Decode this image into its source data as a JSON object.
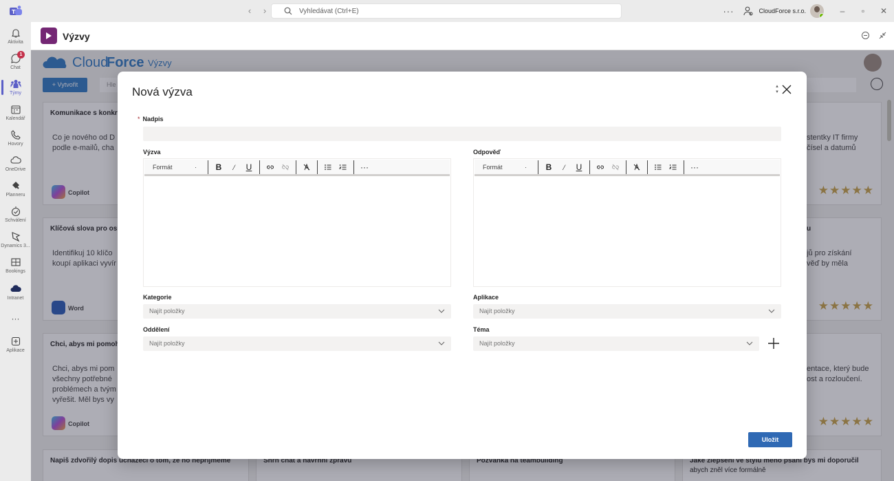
{
  "titlebar": {
    "search_placeholder": "Vyhledávat (Ctrl+E)",
    "more": "···",
    "org_name": "CloudForce s.r.o.",
    "nav_back": "‹",
    "nav_forward": "›",
    "minimize": "–",
    "restore": "▫",
    "close": "✕"
  },
  "rail": {
    "items": [
      {
        "label": "Aktivita",
        "icon": "bell-icon"
      },
      {
        "label": "Chat",
        "icon": "chat-icon",
        "badge": "1"
      },
      {
        "label": "Týmy",
        "icon": "teams-icon",
        "active": true
      },
      {
        "label": "Kalendář",
        "icon": "calendar-icon"
      },
      {
        "label": "Hovory",
        "icon": "phone-icon"
      },
      {
        "label": "OneDrive",
        "icon": "cloud-icon"
      },
      {
        "label": "Planneru",
        "icon": "planner-icon"
      },
      {
        "label": "Schválení",
        "icon": "approvals-icon"
      },
      {
        "label": "Dynamics 3...",
        "icon": "dynamics-icon"
      },
      {
        "label": "Bookings",
        "icon": "bookings-icon"
      },
      {
        "label": "Intranet",
        "icon": "intranet-cloud-icon"
      },
      {
        "label": "···",
        "icon": "more-icon"
      },
      {
        "label": "Aplikace",
        "icon": "add-app-icon"
      }
    ]
  },
  "app_header": {
    "title": "Výzvy"
  },
  "background": {
    "logo_light": "Cloud",
    "logo_bold": "Force",
    "logo_sub": "Výzvy",
    "create_label": "+ Vytvořit",
    "search_partial": "Hle",
    "cards": [
      {
        "title": "Komunikace s konkr",
        "body1": "Co je nového od D",
        "body2": "podle e-mailů, cha",
        "app": "Copilot"
      },
      {
        "title": "Klíčová slova pro osl",
        "body1": "Identifikuj 10 klíčo",
        "body2": "koupí aplikaci vyvír",
        "app": "Word"
      },
      {
        "title": "Chci, abys mi pomoh",
        "body1": "Chci, abys mi pom",
        "body2": "všechny potřebné",
        "body3": "problémech a tvým",
        "body4": "vyřešit. Měl bys vy",
        "app": "Copilot"
      },
      {
        "title": "Napiš zdvořilý dopis uchazeči o tom, že ho nepřijmeme"
      },
      {
        "title": "Shrň chat a navrhni zprávu"
      },
      {
        "title": "Pozvánka na teambuilding"
      },
      {
        "title": "Jaké zlepšení ve stylu mého psaní bys mi doporučil",
        "body1": "abych zněl více formálně"
      }
    ],
    "right_cards": [
      {
        "body1": "stentky IT firmy",
        "body2": "čísel a datumů"
      },
      {
        "title": "u",
        "body1": "jů pro získání",
        "body2": "věď by měla"
      },
      {
        "body1": "entace, který bude",
        "body2": "ost a rozloučení."
      }
    ],
    "stars": "★★★★★"
  },
  "modal": {
    "title": "Nová výzva",
    "required_mark": "*",
    "nadpis_label": "Nadpis",
    "vyzva_label": "Výzva",
    "odpoved_label": "Odpověď",
    "format_label": "Formát",
    "format_caret": "·",
    "toolbar_more": "···",
    "kategorie_label": "Kategorie",
    "aplikace_label": "Aplikace",
    "oddeleni_label": "Oddělení",
    "tema_label": "Téma",
    "dropdown_placeholder": "Najít položky",
    "save_label": "Uložit"
  },
  "colors": {
    "accent": "#5b5fc7",
    "brand": "#2f79c4",
    "app_icon": "#742774",
    "save_button": "#2f69b4",
    "stars": "#c8a34a"
  }
}
